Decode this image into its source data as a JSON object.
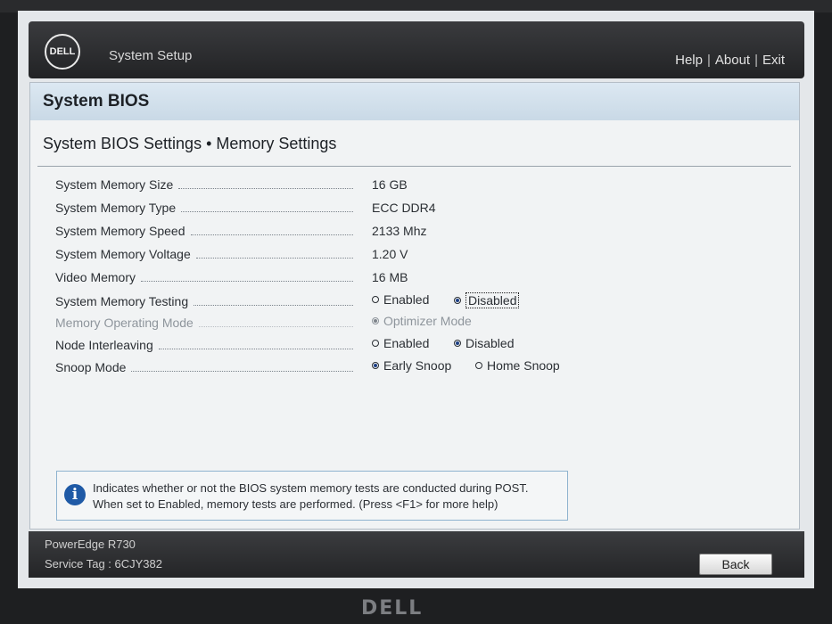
{
  "header": {
    "logo": "DELL",
    "title": "System Setup",
    "links": {
      "help": "Help",
      "about": "About",
      "exit": "Exit",
      "separator": "|"
    }
  },
  "panel": {
    "title": "System BIOS",
    "breadcrumb": "System BIOS Settings • Memory Settings"
  },
  "settings": {
    "memory_size": {
      "label": "System Memory Size",
      "value": "16 GB"
    },
    "memory_type": {
      "label": "System Memory Type",
      "value": "ECC DDR4"
    },
    "memory_speed": {
      "label": "System Memory Speed",
      "value": "2133 Mhz"
    },
    "memory_voltage": {
      "label": "System Memory Voltage",
      "value": "1.20 V"
    },
    "video_memory": {
      "label": "Video Memory",
      "value": "16 MB"
    },
    "memory_testing": {
      "label": "System Memory Testing",
      "options": [
        "Enabled",
        "Disabled"
      ],
      "selected": "Disabled"
    },
    "operating_mode": {
      "label": "Memory Operating Mode",
      "options": [
        "Optimizer Mode"
      ],
      "selected": "Optimizer Mode"
    },
    "node_interleaving": {
      "label": "Node Interleaving",
      "options": [
        "Enabled",
        "Disabled"
      ],
      "selected": "Disabled"
    },
    "snoop_mode": {
      "label": "Snoop Mode",
      "options": [
        "Early Snoop",
        "Home Snoop"
      ],
      "selected": "Early Snoop"
    }
  },
  "help": {
    "icon": "info-icon",
    "line1": "Indicates whether or not the BIOS system memory tests are conducted during POST.",
    "line2": "When set to Enabled, memory tests are performed. (Press <F1> for more help)"
  },
  "footer": {
    "model": "PowerEdge R730",
    "service_tag": "Service Tag : 6CJY382",
    "back_label": "Back"
  },
  "monitor_brand": "DELL",
  "colors": {
    "header": "#2c2d30",
    "panel_title": "#d3e1ec",
    "accent": "#1f5aa6"
  }
}
